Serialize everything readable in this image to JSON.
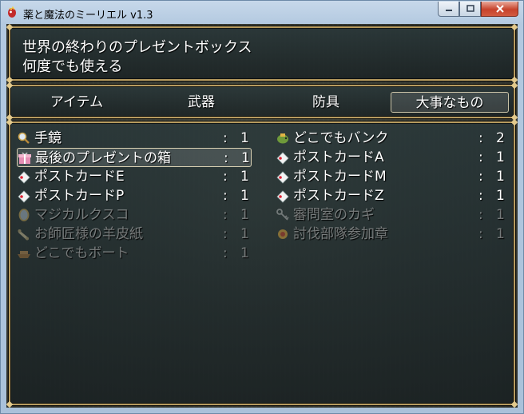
{
  "window": {
    "title": "薬と魔法のミーリエル v1.3",
    "buttons": {
      "minimize": "minimize-icon",
      "maximize": "maximize-icon",
      "close": "close-icon"
    }
  },
  "help": {
    "line1": "世界の終わりのプレゼントボックス",
    "line2": "何度でも使える"
  },
  "categories": [
    {
      "label": "アイテム",
      "selected": false
    },
    {
      "label": "武器",
      "selected": false
    },
    {
      "label": "防具",
      "selected": false
    },
    {
      "label": "大事なもの",
      "selected": true
    }
  ],
  "items_left": [
    {
      "name": "手鏡",
      "colon": ":",
      "qty": "1",
      "icon": "magnifier-icon",
      "enabled": true,
      "selected": false
    },
    {
      "name": "最後のプレゼントの箱",
      "colon": ":",
      "qty": "1",
      "icon": "gift-box-icon",
      "enabled": true,
      "selected": true
    },
    {
      "name": "ポストカードE",
      "colon": ":",
      "qty": "1",
      "icon": "postcard-icon",
      "enabled": true,
      "selected": false
    },
    {
      "name": "ポストカードP",
      "colon": ":",
      "qty": "1",
      "icon": "postcard-icon",
      "enabled": true,
      "selected": false
    },
    {
      "name": "マジカルクスコ",
      "colon": ":",
      "qty": "1",
      "icon": "mirror-icon",
      "enabled": false,
      "selected": false
    },
    {
      "name": "お師匠様の羊皮紙",
      "colon": ":",
      "qty": "1",
      "icon": "scroll-icon",
      "enabled": false,
      "selected": false
    },
    {
      "name": "どこでもボート",
      "colon": ":",
      "qty": "1",
      "icon": "boat-icon",
      "enabled": false,
      "selected": false
    }
  ],
  "items_right": [
    {
      "name": "どこでもバンク",
      "colon": ":",
      "qty": "2",
      "icon": "bank-icon",
      "enabled": true,
      "selected": false
    },
    {
      "name": "ポストカードA",
      "colon": ":",
      "qty": "1",
      "icon": "postcard-icon",
      "enabled": true,
      "selected": false
    },
    {
      "name": "ポストカードM",
      "colon": ":",
      "qty": "1",
      "icon": "postcard-icon",
      "enabled": true,
      "selected": false
    },
    {
      "name": "ポストカードZ",
      "colon": ":",
      "qty": "1",
      "icon": "postcard-icon",
      "enabled": true,
      "selected": false
    },
    {
      "name": "審問室のカギ",
      "colon": ":",
      "qty": "1",
      "icon": "key-icon",
      "enabled": false,
      "selected": false
    },
    {
      "name": "討伐部隊参加章",
      "colon": ":",
      "qty": "1",
      "icon": "medal-icon",
      "enabled": false,
      "selected": false
    }
  ]
}
